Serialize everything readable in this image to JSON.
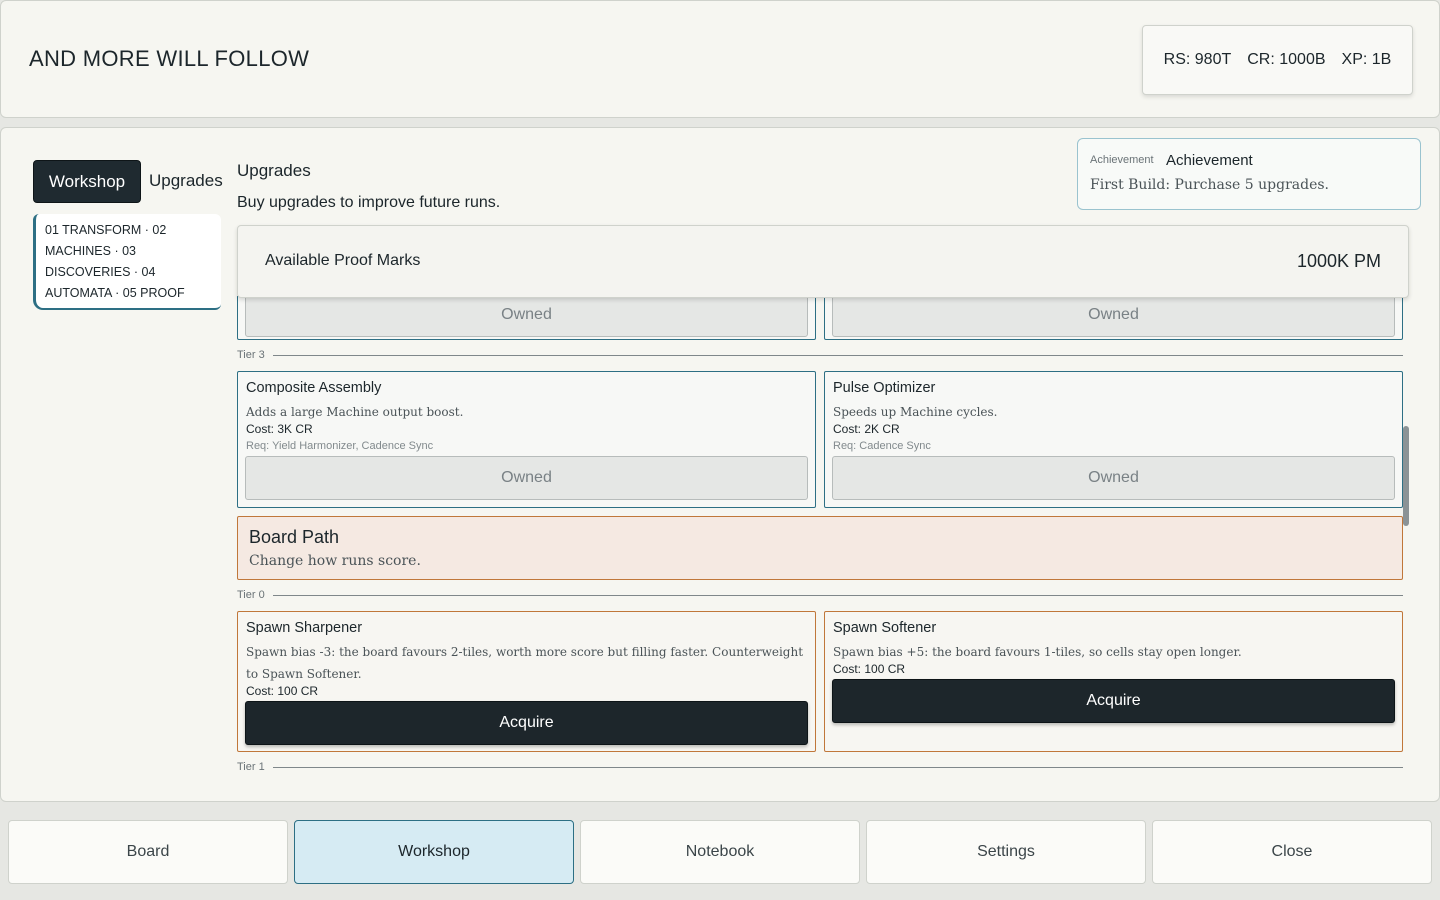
{
  "header": {
    "title": "AND MORE WILL FOLLOW",
    "stats": [
      "RS: 980T",
      "CR: 1000B",
      "XP: 1B"
    ]
  },
  "sidebar": {
    "active_tab": "Workshop",
    "tab2": "Upgrades",
    "chapters": [
      "01 TRANSFORM · 02",
      "MACHINES · 03",
      "DISCOVERIES · 04",
      "AUTOMATA · 05 PROOF"
    ]
  },
  "section": {
    "title": "Upgrades",
    "subtitle": "Buy upgrades to improve future runs."
  },
  "achievement": {
    "tag": "Achievement",
    "head": "Achievement",
    "body": "First Build: Purchase 5 upgrades."
  },
  "proof": {
    "label": "Available Proof Marks",
    "value": "1000K PM"
  },
  "upgrades": {
    "partial": {
      "owned_label": "Owned"
    },
    "tier3": {
      "label": "Tier 3",
      "cards": [
        {
          "name": "Composite Assembly",
          "desc": "Adds a large Machine output boost.",
          "cost": "Cost: 3K CR",
          "req": "Req: Yield Harmonizer, Cadence Sync",
          "button": "Owned"
        },
        {
          "name": "Pulse Optimizer",
          "desc": "Speeds up Machine cycles.",
          "cost": "Cost: 2K CR",
          "req": "Req: Cadence Sync",
          "button": "Owned"
        }
      ]
    },
    "board_path": {
      "head": "Board Path",
      "body": "Change how runs score."
    },
    "tier0": {
      "label": "Tier 0",
      "cards": [
        {
          "name": "Spawn Sharpener",
          "desc": "Spawn bias -3: the board favours 2-tiles, worth more score but filling faster. Counterweight to Spawn Softener.",
          "cost": "Cost: 100 CR",
          "button": "Acquire"
        },
        {
          "name": "Spawn Softener",
          "desc": "Spawn bias +5: the board favours 1-tiles, so cells stay open longer.",
          "cost": "Cost: 100 CR",
          "button": "Acquire"
        }
      ]
    },
    "tier1": {
      "label": "Tier 1"
    }
  },
  "nav": [
    "Board",
    "Workshop",
    "Notebook",
    "Settings",
    "Close"
  ]
}
